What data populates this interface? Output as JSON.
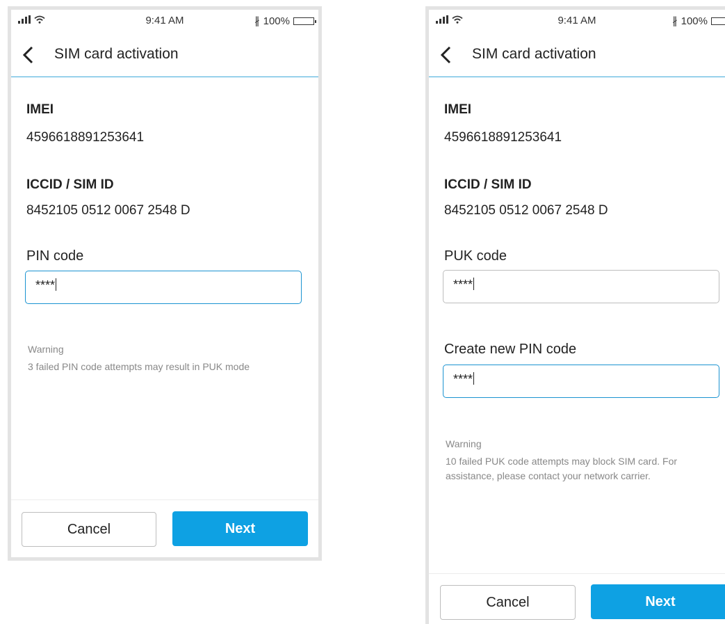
{
  "status_bar": {
    "time": "9:41 AM",
    "battery": "100%",
    "battery_level": 1.0
  },
  "colors": {
    "accent": "#0ea1e3",
    "divider": "#3fa9d9",
    "focus_border": "#1a93d1",
    "warning_text": "#888888"
  },
  "icons": {
    "back": "chevron-left-icon",
    "signal": "signal-icon",
    "wifi": "wifi-icon",
    "bluetooth": "bluetooth-icon",
    "battery": "battery-icon"
  },
  "screens": [
    {
      "title": "SIM card activation",
      "imei_label": "IMEI",
      "imei_value": "4596618891253641",
      "iccid_label": "ICCID / SIM ID",
      "iccid_value": "8452105 0512 0067 2548 D",
      "pin_label": "PIN code",
      "pin_value": "****",
      "warning_title": "Warning",
      "warning_text": "3 failed PIN code attempts may result in PUK mode",
      "cancel_label": "Cancel",
      "next_label": "Next"
    },
    {
      "title": "SIM card activation",
      "imei_label": "IMEI",
      "imei_value": "4596618891253641",
      "iccid_label": "ICCID / SIM ID",
      "iccid_value": "8452105 0512 0067 2548 D",
      "puk_label": "PUK code",
      "puk_value": "****",
      "new_pin_label": "Create new PIN code",
      "new_pin_value": "****",
      "warning_title": "Warning",
      "warning_text": "10 failed PUK code attempts may block SIM card. For assistance, please contact your network carrier.",
      "cancel_label": "Cancel",
      "next_label": "Next"
    }
  ]
}
